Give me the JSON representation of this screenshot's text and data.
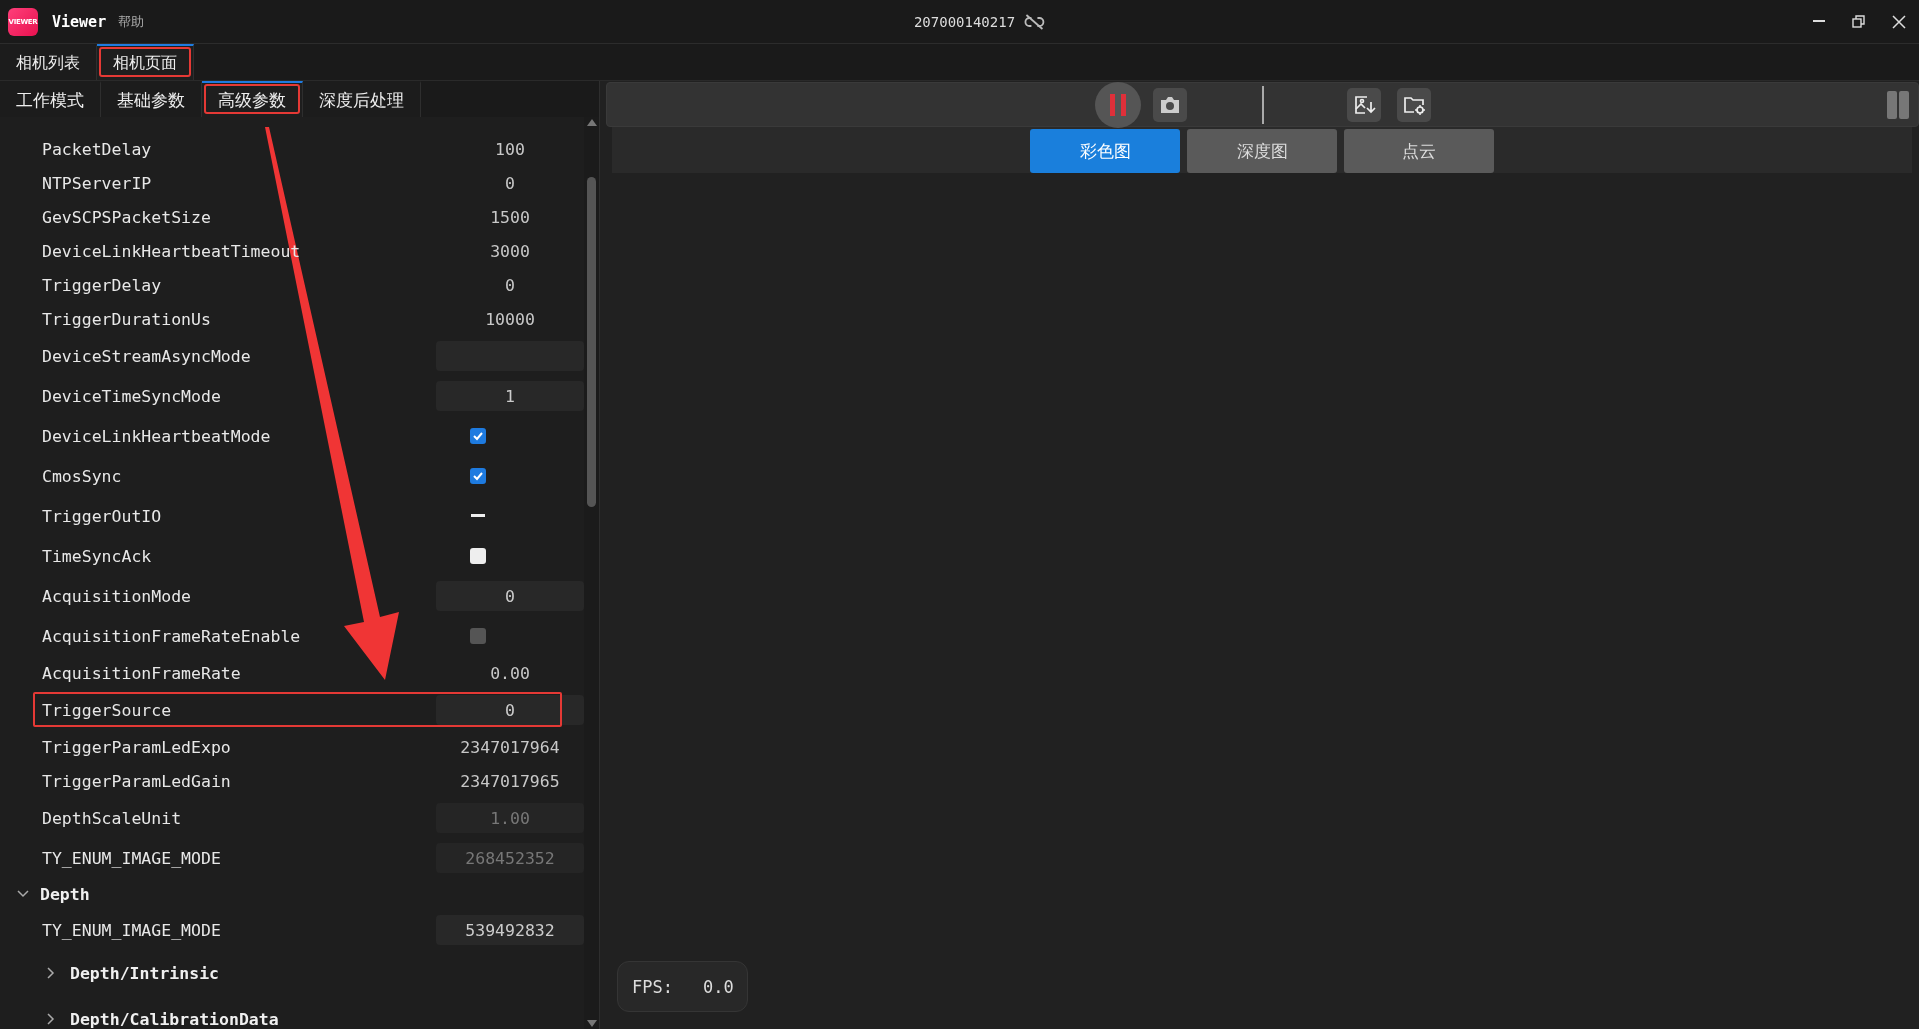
{
  "window": {
    "logo_text": "VIEWER",
    "app_name": "Viewer",
    "menu": [
      "帮助"
    ],
    "device_serial": "207000140217",
    "connected": false
  },
  "page_tabs": [
    {
      "label": "相机列表",
      "selected": false,
      "highlighted": false
    },
    {
      "label": "相机页面",
      "selected": true,
      "highlighted": true
    }
  ],
  "settings_tabs": [
    {
      "label": "工作模式",
      "selected": false,
      "highlighted": false
    },
    {
      "label": "基础参数",
      "selected": false,
      "highlighted": false
    },
    {
      "label": "高级参数",
      "selected": true,
      "highlighted": true
    },
    {
      "label": "深度后处理",
      "selected": false,
      "highlighted": false
    }
  ],
  "parameters": [
    {
      "kind": "value",
      "name": "PacketDelay",
      "value": "100",
      "highlighted": false
    },
    {
      "kind": "value",
      "name": "NTPServerIP",
      "value": "0",
      "highlighted": false
    },
    {
      "kind": "value",
      "name": "GevSCPSPacketSize",
      "value": "1500",
      "highlighted": false
    },
    {
      "kind": "value",
      "name": "DeviceLinkHeartbeatTimeout",
      "value": "3000",
      "highlighted": false
    },
    {
      "kind": "value",
      "name": "TriggerDelay",
      "value": "0",
      "highlighted": false
    },
    {
      "kind": "value",
      "name": "TriggerDurationUs",
      "value": "10000",
      "highlighted": false
    },
    {
      "kind": "field",
      "name": "DeviceStreamAsyncMode",
      "highlighted": false
    },
    {
      "kind": "field",
      "name": "DeviceTimeSyncMode",
      "value": "1",
      "disabled": false,
      "highlighted": false
    },
    {
      "kind": "checkbox",
      "name": "DeviceLinkHeartbeatMode",
      "checked": true,
      "disabled": false,
      "highlighted": false
    },
    {
      "kind": "checkbox",
      "name": "CmosSync",
      "checked": true,
      "disabled": false,
      "highlighted": false
    },
    {
      "kind": "checkbox",
      "name": "TriggerOutIO",
      "checked": false,
      "indeterminate": true,
      "disabled": false,
      "highlighted": false
    },
    {
      "kind": "checkbox",
      "name": "TimeSyncAck",
      "checked": false,
      "disabled": false,
      "highlighted": false
    },
    {
      "kind": "field",
      "name": "AcquisitionMode",
      "value": "0",
      "disabled": false,
      "highlighted": false
    },
    {
      "kind": "checkbox",
      "name": "AcquisitionFrameRateEnable",
      "checked": false,
      "disabled": true,
      "highlighted": false
    },
    {
      "kind": "value",
      "name": "AcquisitionFrameRate",
      "value": "0.00",
      "highlighted": false
    },
    {
      "kind": "field",
      "name": "TriggerSource",
      "value": "0",
      "disabled": false,
      "highlighted": true
    },
    {
      "kind": "value",
      "name": "TriggerParamLedExpo",
      "value": "2347017964",
      "highlighted": false
    },
    {
      "kind": "value",
      "name": "TriggerParamLedGain",
      "value": "2347017965",
      "highlighted": false
    },
    {
      "kind": "field",
      "name": "DepthScaleUnit",
      "value": "1.00",
      "disabled": true,
      "highlighted": false
    },
    {
      "kind": "field",
      "name": "TY_ENUM_IMAGE_MODE",
      "value": "268452352",
      "disabled": true,
      "highlighted": false
    },
    {
      "kind": "group",
      "name": "Depth",
      "expanded": true,
      "children": [
        {
          "kind": "field",
          "name": "TY_ENUM_IMAGE_MODE",
          "value": "539492832",
          "disabled": false,
          "highlighted": false
        },
        {
          "kind": "group",
          "name": "Depth/Intrinsic",
          "expanded": false
        },
        {
          "kind": "group",
          "name": "Depth/CalibrationData",
          "expanded": false
        }
      ]
    }
  ],
  "stream": {
    "streaming": true,
    "view_tabs": [
      {
        "label": "彩色图",
        "selected": true
      },
      {
        "label": "深度图",
        "selected": false
      },
      {
        "label": "点云",
        "selected": false
      }
    ],
    "fps_label": "FPS:",
    "fps_value": "0.0"
  },
  "annotation": {
    "arrow": true
  }
}
